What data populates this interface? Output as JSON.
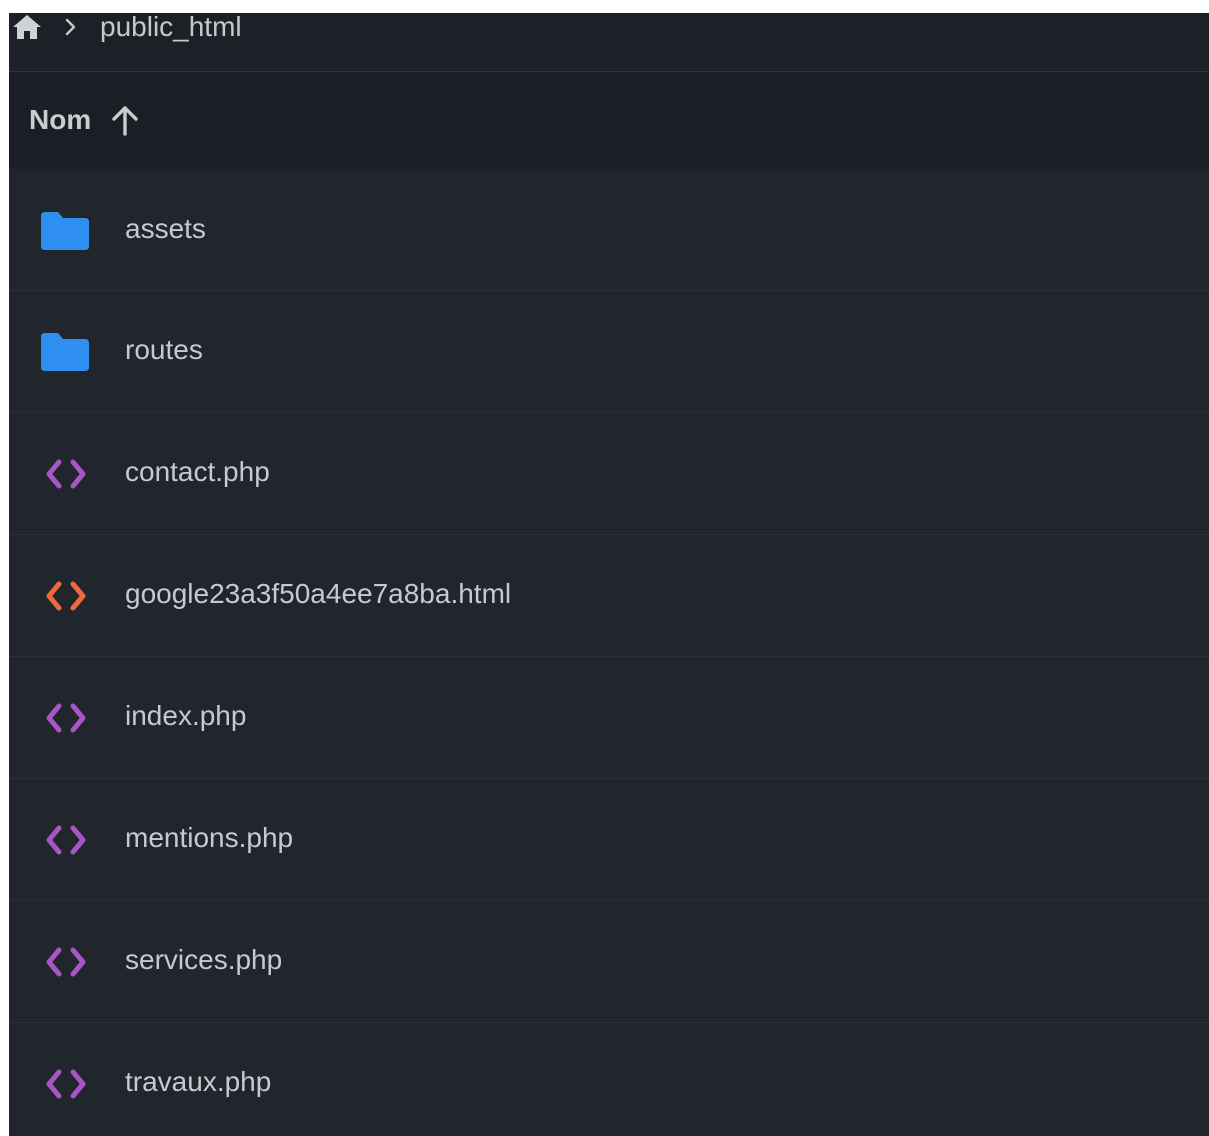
{
  "breadcrumb": {
    "home_icon": "home-icon",
    "separator_icon": "chevron-right-icon",
    "current": "public_html"
  },
  "header": {
    "name_label": "Nom",
    "sort_icon": "arrow-up-icon"
  },
  "colors": {
    "folder": "#2f8ff0",
    "php": "#a755c7",
    "html": "#ee6a3a",
    "background": "#21262d",
    "text": "#c5cad0"
  },
  "files": [
    {
      "name": "assets",
      "type": "folder",
      "icon": "folder-icon"
    },
    {
      "name": "routes",
      "type": "folder",
      "icon": "folder-icon"
    },
    {
      "name": "contact.php",
      "type": "php",
      "icon": "code-icon"
    },
    {
      "name": "google23a3f50a4ee7a8ba.html",
      "type": "html",
      "icon": "code-icon"
    },
    {
      "name": "index.php",
      "type": "php",
      "icon": "code-icon"
    },
    {
      "name": "mentions.php",
      "type": "php",
      "icon": "code-icon"
    },
    {
      "name": "services.php",
      "type": "php",
      "icon": "code-icon"
    },
    {
      "name": "travaux.php",
      "type": "php",
      "icon": "code-icon"
    }
  ]
}
